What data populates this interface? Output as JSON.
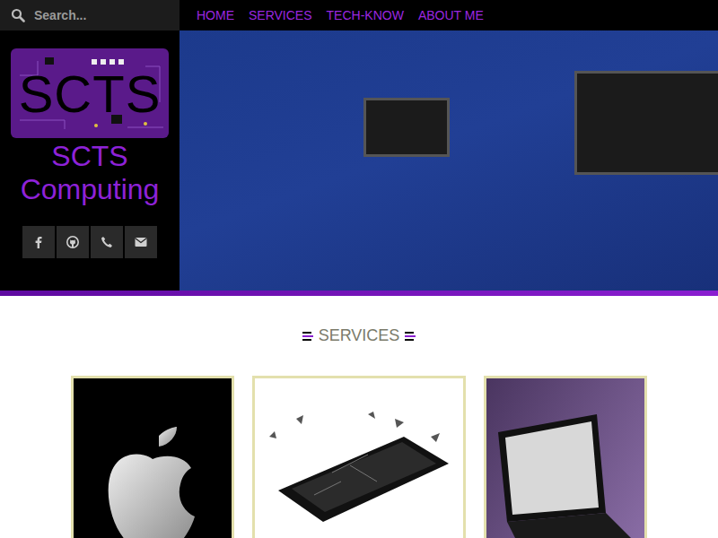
{
  "search": {
    "placeholder": "Search..."
  },
  "nav": [
    {
      "label": "HOME",
      "selected": false
    },
    {
      "label": "SERVICES",
      "selected": false
    },
    {
      "label": "TECH-KNOW",
      "selected": false
    },
    {
      "label": "ABOUT ME",
      "selected": false
    }
  ],
  "logo": {
    "text": "SCTS"
  },
  "brand": "SCTS Computing",
  "social": [
    {
      "kind": "facebook"
    },
    {
      "kind": "github"
    },
    {
      "kind": "phone"
    },
    {
      "kind": "email"
    }
  ],
  "section": {
    "title": "SERVICES"
  },
  "cards": [
    {
      "kind": "apple"
    },
    {
      "kind": "phone"
    },
    {
      "kind": "laptop"
    }
  ]
}
